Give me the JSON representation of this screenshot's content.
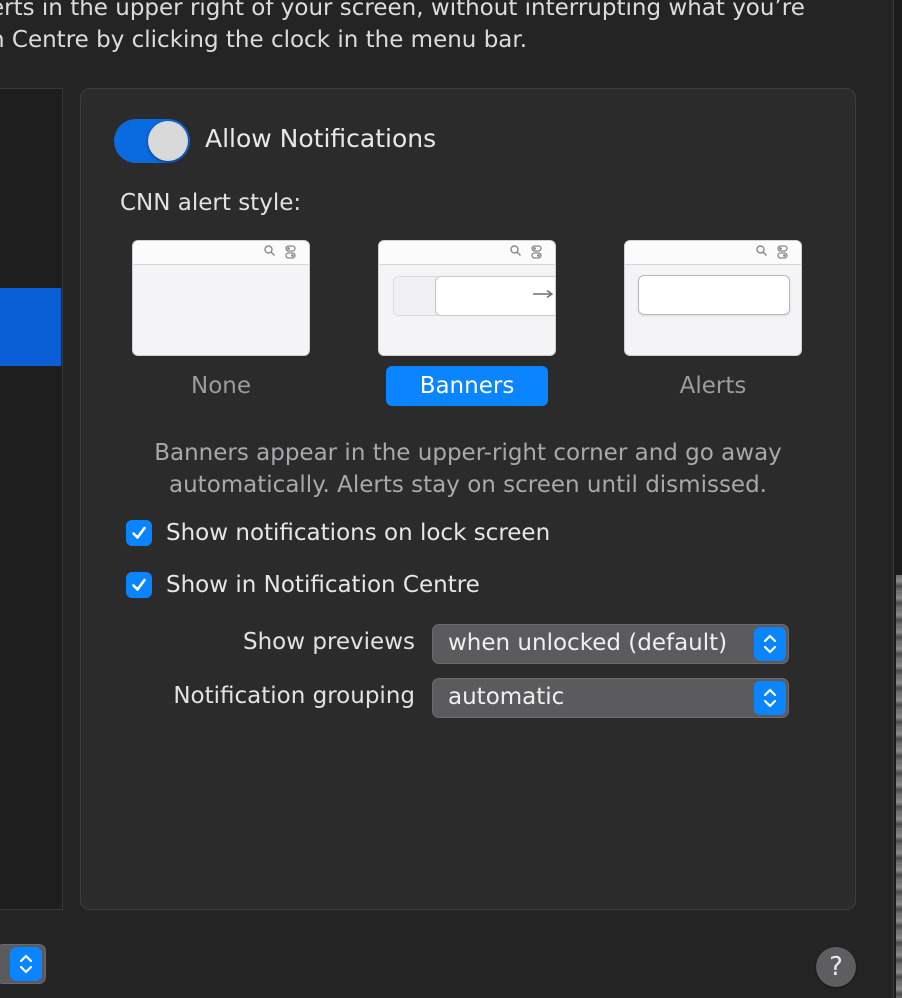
{
  "header": {
    "line1": "erts in the upper right of your screen, without interrupting what you’re",
    "line2": "n Centre by clicking the clock in the menu bar."
  },
  "notifications": {
    "allow_label": "Allow Notifications",
    "allow_enabled": true,
    "style_label": "CNN alert style:",
    "styles": [
      {
        "label": "None",
        "selected": false
      },
      {
        "label": "Banners",
        "selected": true
      },
      {
        "label": "Alerts",
        "selected": false
      }
    ],
    "description_line1": "Banners appear in the upper-right corner and go away",
    "description_line2": "automatically. Alerts stay on screen until dismissed.",
    "checkboxes": [
      {
        "label": "Show notifications on lock screen",
        "checked": true
      },
      {
        "label": "Show in Notification Centre",
        "checked": true
      }
    ],
    "previews": {
      "label": "Show previews",
      "value": "when unlocked (default)"
    },
    "grouping": {
      "label": "Notification grouping",
      "value": "automatic"
    }
  },
  "help": {
    "symbol": "?"
  },
  "colors": {
    "accent": "#0a84ff",
    "selection": "#0a5fd4",
    "window_bg": "#242425"
  }
}
